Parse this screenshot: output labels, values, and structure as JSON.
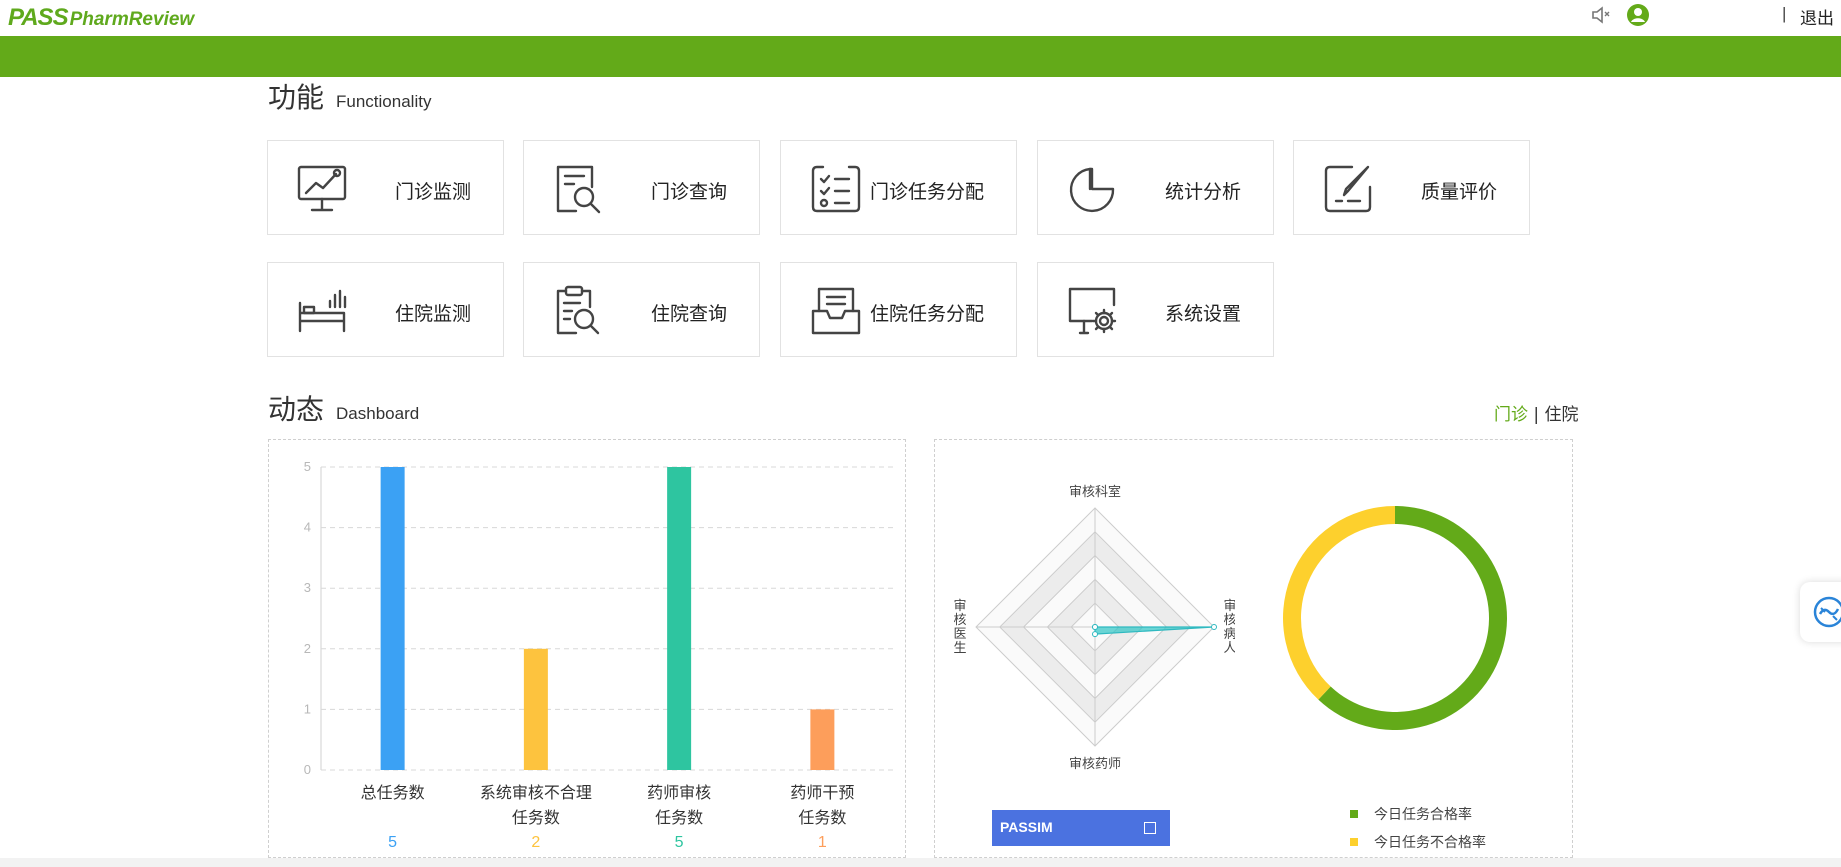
{
  "header": {
    "logo_part1": "PASS",
    "logo_part2": "PharmReview",
    "separator": "|",
    "logout_label": "退出"
  },
  "functionality": {
    "title_cn": "功能",
    "title_en": "Functionality",
    "tiles": [
      {
        "label": "门诊监测",
        "icon": "monitor-chart-icon"
      },
      {
        "label": "门诊查询",
        "icon": "document-search-icon"
      },
      {
        "label": "门诊任务分配",
        "icon": "checklist-icon"
      },
      {
        "label": "统计分析",
        "icon": "pie-chart-icon"
      },
      {
        "label": "质量评价",
        "icon": "edit-document-icon"
      },
      {
        "label": "住院监测",
        "icon": "hospital-bed-icon"
      },
      {
        "label": "住院查询",
        "icon": "clipboard-search-icon"
      },
      {
        "label": "住院任务分配",
        "icon": "inbox-tray-icon"
      },
      {
        "label": "系统设置",
        "icon": "settings-monitor-icon"
      }
    ]
  },
  "dashboard": {
    "title_cn": "动态",
    "title_en": "Dashboard",
    "toggle": {
      "outpatient": "门诊",
      "separator": "|",
      "inpatient": "住院"
    },
    "radar": {
      "axes": [
        "审核科室",
        "审核病人",
        "审核药师",
        "审核医生"
      ],
      "value_labels": [],
      "max": 5
    },
    "donut": {
      "legend": [
        {
          "label": "今日任务合格率",
          "color": "#63aa19"
        },
        {
          "label": "今日任务不合格率",
          "color": "#fdd02d"
        }
      ]
    },
    "passim_label": "PASSIM"
  },
  "colors": {
    "brand_green": "#63aa19",
    "bar_blue": "#3ba1f4",
    "bar_yellow": "#fdc33e",
    "bar_teal": "#2ec5a0",
    "bar_orange": "#fd9e5b",
    "donut_yellow": "#fdd02d"
  },
  "chart_data": [
    {
      "type": "bar",
      "categories": [
        [
          "总任务数"
        ],
        [
          "系统审核不合理",
          "任务数"
        ],
        [
          "药师审核",
          "任务数"
        ],
        [
          "药师干预",
          "任务数"
        ]
      ],
      "values": [
        5,
        2,
        5,
        1
      ],
      "colors": [
        "#3ba1f4",
        "#fdc33e",
        "#2ec5a0",
        "#fd9e5b"
      ],
      "ylim": [
        0,
        5
      ],
      "yticks": [
        0,
        1,
        2,
        3,
        4,
        5
      ],
      "grid": true
    },
    {
      "type": "radar",
      "axes": [
        "审核科室",
        "审核病人",
        "审核药师",
        "审核医生"
      ],
      "values": [
        0,
        5,
        0.3,
        0
      ],
      "max": 5
    },
    {
      "type": "pie",
      "labels": [
        "今日任务合格率",
        "今日任务不合格率"
      ],
      "values": [
        62,
        38
      ],
      "colors": [
        "#63aa19",
        "#fdd02d"
      ]
    }
  ]
}
